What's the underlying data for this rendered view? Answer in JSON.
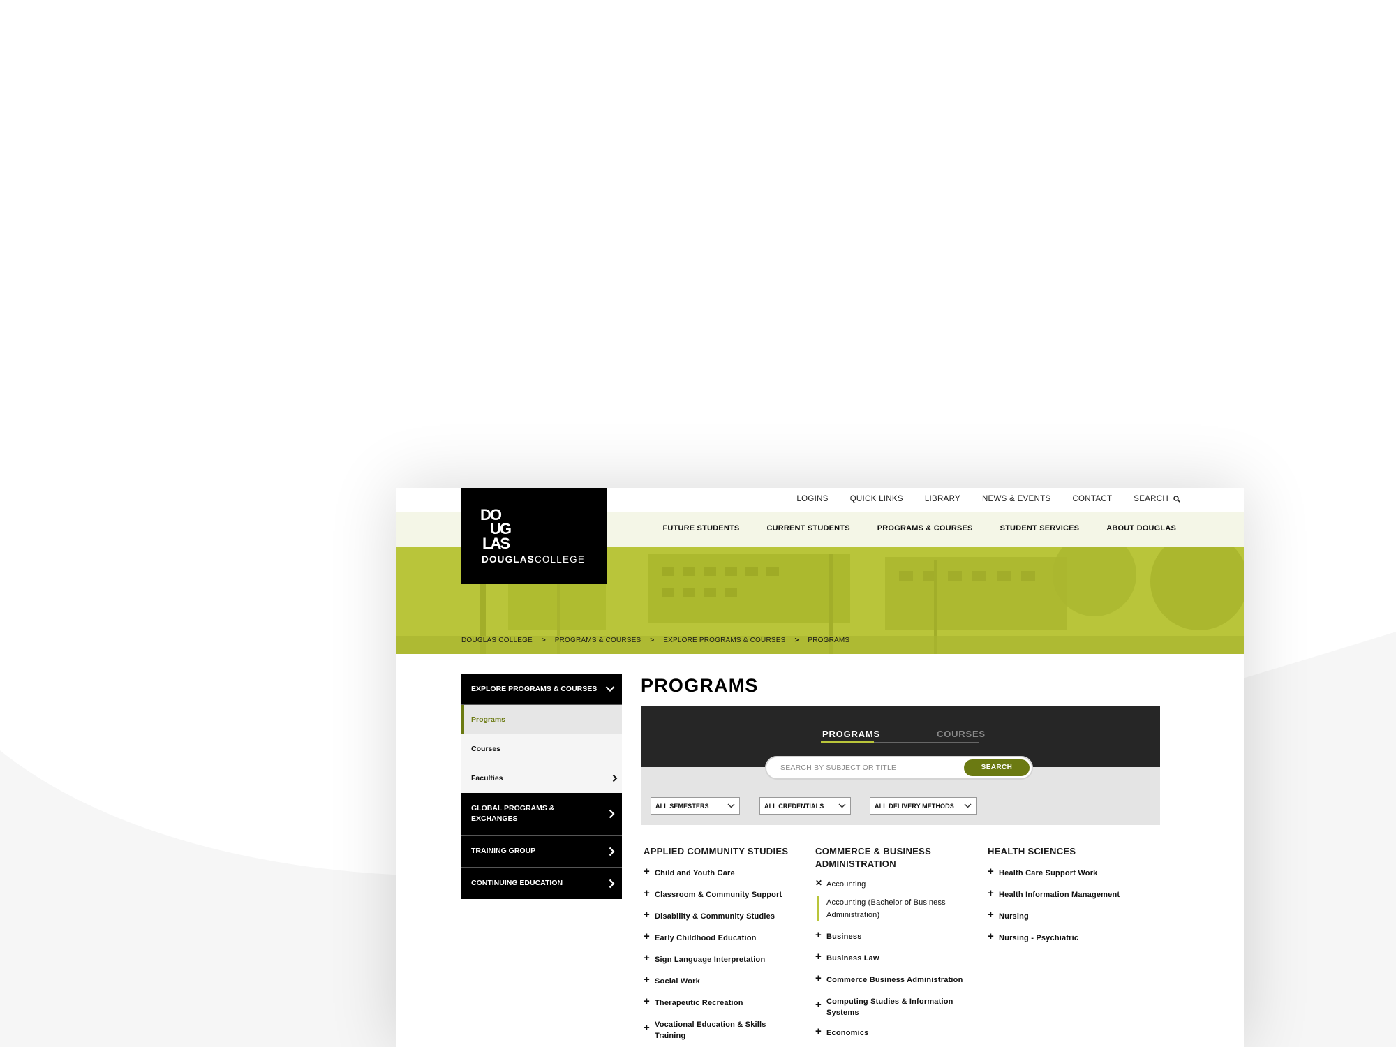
{
  "site": {
    "logo": {
      "mark": "DOUGLAS",
      "name_bold": "DOUGLAS",
      "name_light": "COLLEGE"
    },
    "top_nav": [
      "LOGINS",
      "QUICK LINKS",
      "LIBRARY",
      "NEWS & EVENTS",
      "CONTACT"
    ],
    "search_label": "SEARCH",
    "main_nav": [
      "FUTURE STUDENTS",
      "CURRENT STUDENTS",
      "PROGRAMS & COURSES",
      "STUDENT SERVICES",
      "ABOUT DOUGLAS"
    ],
    "breadcrumb": [
      "DOUGLAS COLLEGE",
      "PROGRAMS & COURSES",
      "EXPLORE PROGRAMS & COURSES",
      "PROGRAMS"
    ],
    "breadcrumb_sep": ">"
  },
  "sidebar": {
    "header": "EXPLORE PROGRAMS & COURSES",
    "sub_items": [
      "Programs",
      "Courses",
      "Faculties"
    ],
    "sections": [
      "GLOBAL PROGRAMS & EXCHANGES",
      "TRAINING GROUP",
      "CONTINUING EDUCATION"
    ]
  },
  "page": {
    "title": "PROGRAMS",
    "tabs": [
      "PROGRAMS",
      "COURSES"
    ],
    "search_placeholder": "SEARCH BY SUBJECT OR TITLE",
    "search_button": "SEARCH",
    "filters": [
      "ALL SEMESTERS",
      "ALL CREDENTIALS",
      "ALL DELIVERY METHODS"
    ]
  },
  "columns": [
    {
      "heading": "APPLIED COMMUNITY STUDIES",
      "items": [
        "Child and Youth Care",
        "Classroom & Community Support",
        "Disability & Community Studies",
        "Early Childhood Education",
        "Sign Language Interpretation",
        "Social Work",
        "Therapeutic Recreation",
        "Vocational Education & Skills Training"
      ]
    },
    {
      "heading": "COMMERCE & BUSINESS ADMINISTRATION",
      "expanded_item": "Accounting",
      "expanded_sub": "Accounting (Bachelor of Business Administration)",
      "items": [
        "Business",
        "Business Law",
        "Commerce Business Administration",
        "Computing Studies & Information Systems",
        "Economics"
      ]
    },
    {
      "heading": "HEALTH SCIENCES",
      "items": [
        "Health Care Support Work",
        "Health Information Management",
        "Nursing",
        "Nursing - Psychiatric"
      ]
    }
  ],
  "colors": {
    "accent_green": "#6b7a12",
    "hero_lime": "#b9c53a",
    "dark_panel": "#262626",
    "header_tint": "#f4f6e7"
  }
}
